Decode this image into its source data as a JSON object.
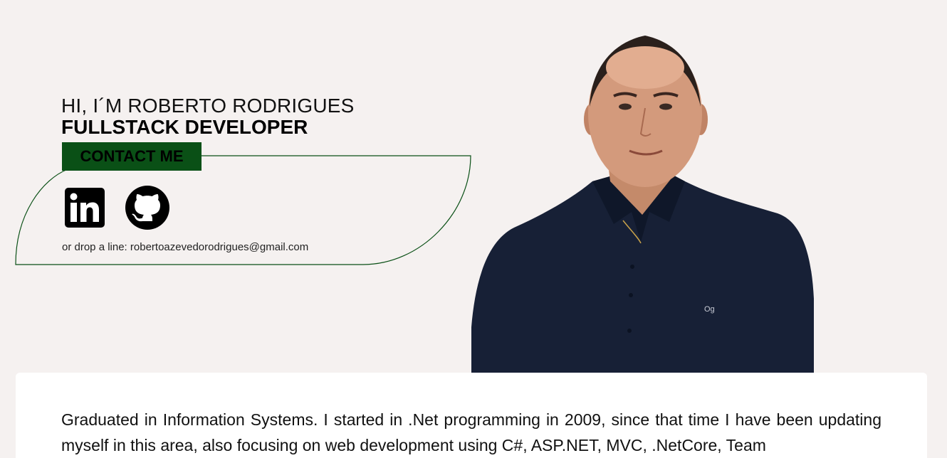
{
  "hero": {
    "greeting": "HI, I´M ROBERTO RODRIGUES",
    "role": "FULLSTACK DEVELOPER",
    "contact_label": "CONTACT ME",
    "email_prefix": "or drop a line: ",
    "email": "robertoazevedorodrigues@gmail.com",
    "social": [
      {
        "name": "LinkedIn",
        "icon": "linkedin-icon"
      },
      {
        "name": "GitHub",
        "icon": "github-icon"
      }
    ]
  },
  "about": {
    "text": "Graduated in Information Systems. I started in .Net programming in 2009, since that time I have been updating myself in this area, also focusing on web development using C#, ASP.NET, MVC, .NetCore, Team"
  },
  "colors": {
    "background": "#f5f1f0",
    "accent": "#0a5016",
    "card": "#ffffff",
    "shirt": "#172036"
  }
}
